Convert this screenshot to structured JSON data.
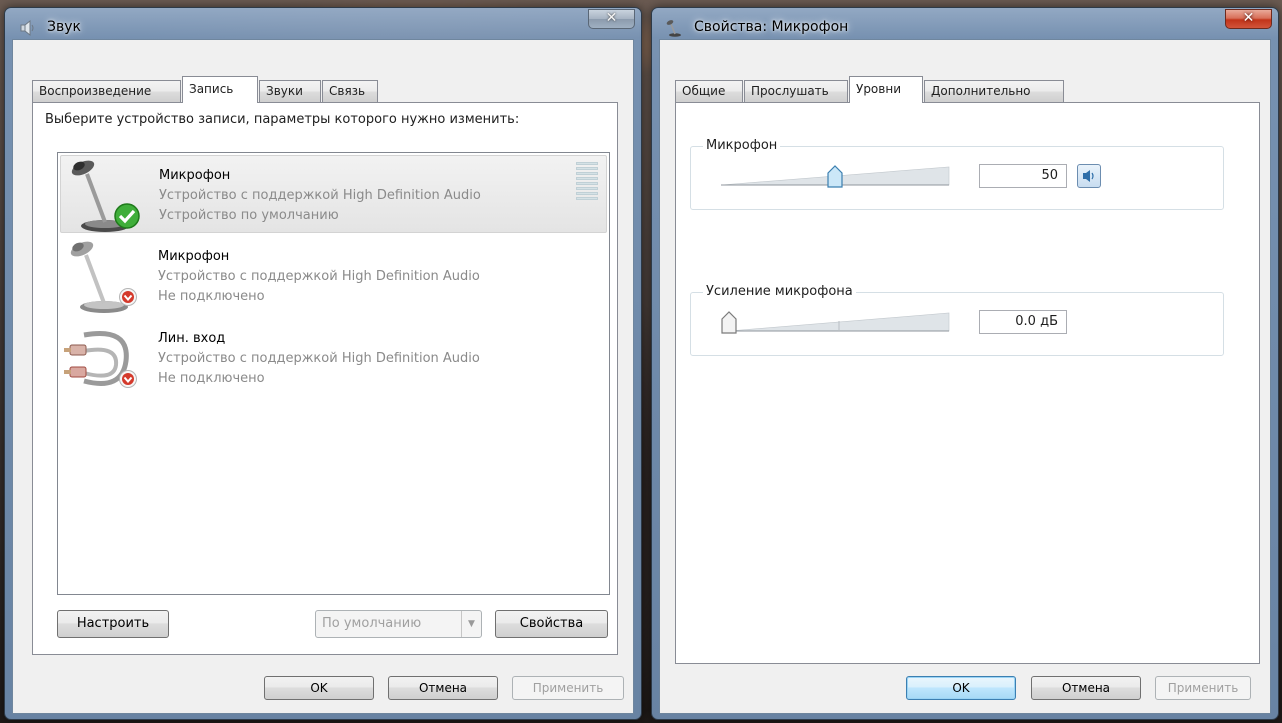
{
  "sound_window": {
    "title": "Звук",
    "tabs": [
      "Воспроизведение",
      "Запись",
      "Звуки",
      "Связь"
    ],
    "active_tab": 1,
    "instruction": "Выберите устройство записи, параметры которого нужно изменить:",
    "devices": [
      {
        "name": "Микрофон",
        "description": "Устройство с поддержкой High Definition Audio",
        "status": "Устройство по умолчанию",
        "selected": true,
        "badge": "green-check-icon"
      },
      {
        "name": "Микрофон",
        "description": "Устройство с поддержкой High Definition Audio",
        "status": "Не подключено",
        "selected": false,
        "badge": "red-down-arrow-icon"
      },
      {
        "name": "Лин. вход",
        "description": "Устройство с поддержкой High Definition Audio",
        "status": "Не подключено",
        "selected": false,
        "badge": "red-down-arrow-icon"
      }
    ],
    "configure_label": "Настроить",
    "default_combo_label": "По умолчанию",
    "properties_label": "Свойства",
    "ok_label": "OK",
    "cancel_label": "Отмена",
    "apply_label": "Применить"
  },
  "properties_window": {
    "title": "Свойства: Микрофон",
    "tabs": [
      "Общие",
      "Прослушать",
      "Уровни",
      "Дополнительно"
    ],
    "active_tab": 2,
    "mic_group_label": "Микрофон",
    "mic_level": "50",
    "mic_level_fraction": 0.5,
    "boost_group_label": "Усиление микрофона",
    "boost_value": "0.0 дБ",
    "boost_fraction": 0.0,
    "ok_label": "OK",
    "cancel_label": "Отмена",
    "apply_label": "Применить"
  },
  "colors": {
    "selection_bg": "#e4e4e4",
    "disabled_text": "#a0a0a0",
    "close_red": "#c2341a"
  }
}
